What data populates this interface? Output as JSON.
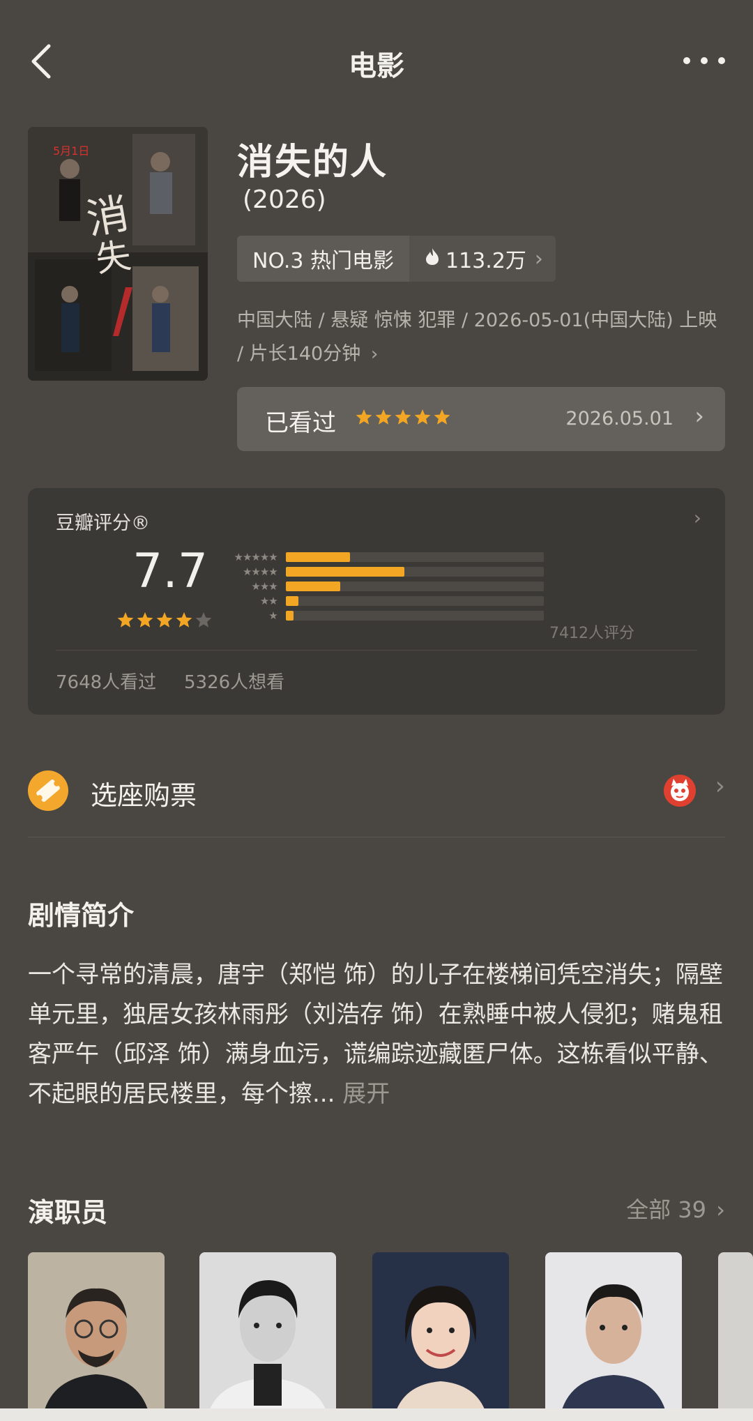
{
  "header": {
    "title": "电影"
  },
  "movie": {
    "title": "消失的人",
    "year": "(2026)",
    "rank": "NO.3 热门电影",
    "heat": "113.2万",
    "meta_line": "中国大陆 / 悬疑 惊悚 犯罪 / 2026-05-01(中国大陆) 上映 / 片长140分钟"
  },
  "user_status": {
    "label": "已看过",
    "date": "2026.05.01",
    "stars": 5
  },
  "rating": {
    "label": "豆瓣评分®",
    "score": "7.7",
    "stars": 4,
    "distribution": [
      0.25,
      0.46,
      0.21,
      0.05,
      0.03
    ],
    "count": "7412人评分",
    "seen": "7648人看过",
    "want": "5326人想看"
  },
  "ticket": {
    "label": "选座购票"
  },
  "synopsis": {
    "title": "剧情简介",
    "text": "一个寻常的清晨，唐宇（郑恺 饰）的儿子在楼梯间凭空消失；隔壁单元里，独居女孩林雨彤（刘浩存 饰）在熟睡中被人侵犯；赌鬼租客严午（邱泽 饰）满身血污，谎编踪迹藏匿尸体。这栋看似平静、不起眼的居民楼里，每个擦...",
    "expand": "展开"
  },
  "cast": {
    "title": "演职员",
    "all": "全部 39"
  },
  "colors": {
    "accent": "#f3a624",
    "background": "#4a4743",
    "card": "#3b3936"
  },
  "icons": [
    "back-arrow-icon",
    "more-dots-icon",
    "flame-icon",
    "chevron-right-icon",
    "star-icon",
    "ticket-icon",
    "maoyan-cat-icon"
  ]
}
